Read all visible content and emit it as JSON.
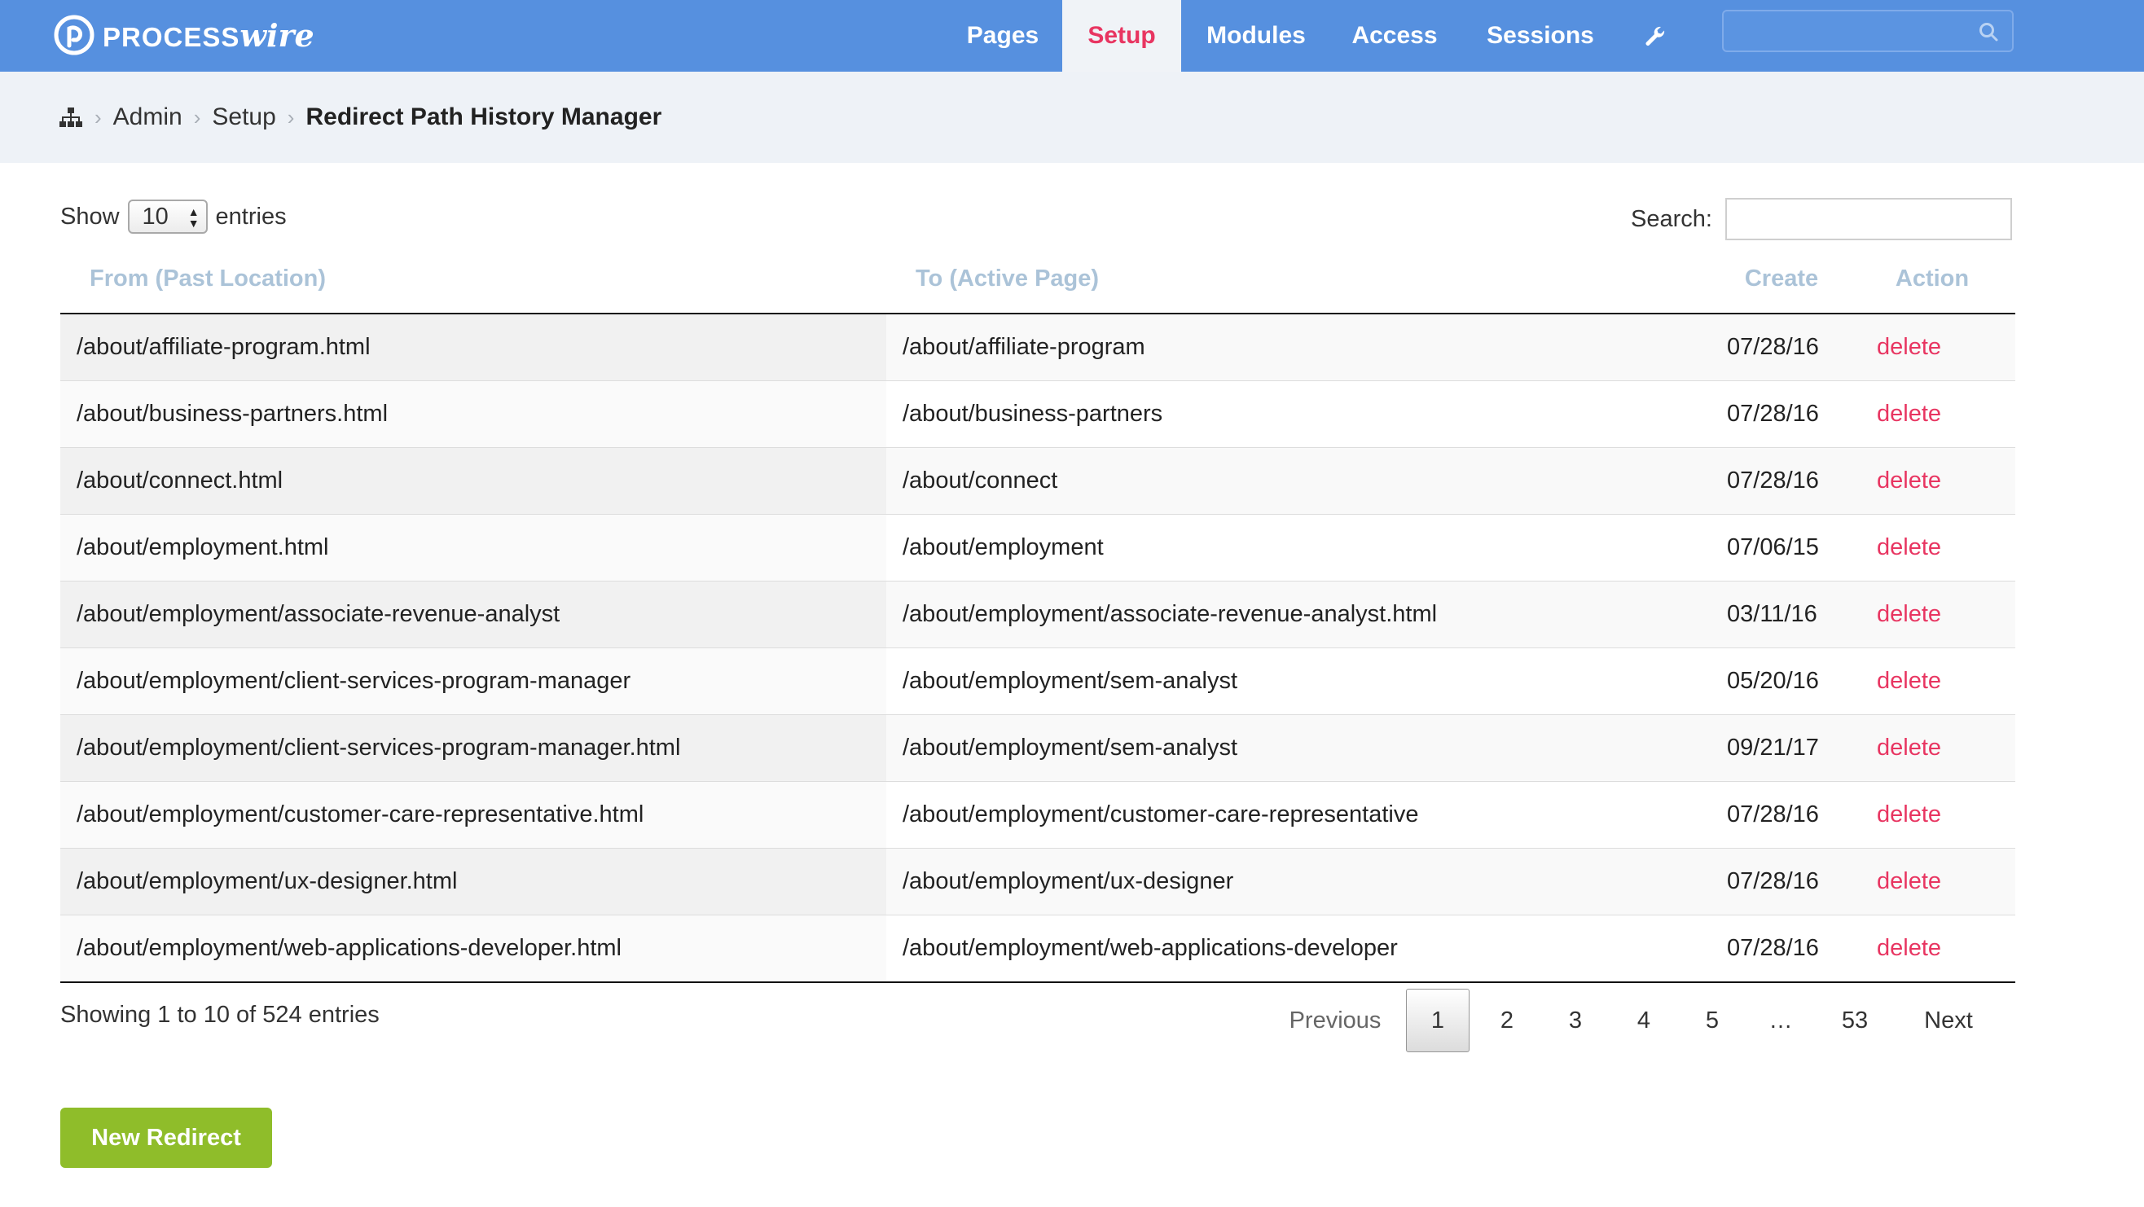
{
  "app": {
    "logo_text_a": "PROCESS",
    "logo_text_b": "wire",
    "brand_color": "#5690df",
    "accent_color": "#e83561"
  },
  "nav": {
    "items": [
      {
        "label": "Pages",
        "active": false
      },
      {
        "label": "Setup",
        "active": true
      },
      {
        "label": "Modules",
        "active": false
      },
      {
        "label": "Access",
        "active": false
      },
      {
        "label": "Sessions",
        "active": false
      }
    ],
    "tools_icon": "wrench-icon",
    "search_icon": "search-icon"
  },
  "breadcrumb": {
    "home_icon": "sitemap-icon",
    "items": [
      "Admin",
      "Setup"
    ],
    "current": "Redirect Path History Manager"
  },
  "controls": {
    "show_label": "Show",
    "entries_value": "10",
    "entries_label": "entries",
    "search_label": "Search:",
    "search_value": ""
  },
  "table": {
    "headers": [
      "From (Past Location)",
      "To (Active Page)",
      "Create",
      "Action"
    ],
    "rows": [
      {
        "from": "/about/affiliate-program.html",
        "to": "/about/affiliate-program",
        "created": "07/28/16",
        "action": "delete"
      },
      {
        "from": "/about/business-partners.html",
        "to": "/about/business-partners",
        "created": "07/28/16",
        "action": "delete"
      },
      {
        "from": "/about/connect.html",
        "to": "/about/connect",
        "created": "07/28/16",
        "action": "delete"
      },
      {
        "from": "/about/employment.html",
        "to": "/about/employment",
        "created": "07/06/15",
        "action": "delete"
      },
      {
        "from": "/about/employment/associate-revenue-analyst",
        "to": "/about/employment/associate-revenue-analyst.html",
        "created": "03/11/16",
        "action": "delete"
      },
      {
        "from": "/about/employment/client-services-program-manager",
        "to": "/about/employment/sem-analyst",
        "created": "05/20/16",
        "action": "delete"
      },
      {
        "from": "/about/employment/client-services-program-manager.html",
        "to": "/about/employment/sem-analyst",
        "created": "09/21/17",
        "action": "delete"
      },
      {
        "from": "/about/employment/customer-care-representative.html",
        "to": "/about/employment/customer-care-representative",
        "created": "07/28/16",
        "action": "delete"
      },
      {
        "from": "/about/employment/ux-designer.html",
        "to": "/about/employment/ux-designer",
        "created": "07/28/16",
        "action": "delete"
      },
      {
        "from": "/about/employment/web-applications-developer.html",
        "to": "/about/employment/web-applications-developer",
        "created": "07/28/16",
        "action": "delete"
      }
    ]
  },
  "footer": {
    "info": "Showing 1 to 10 of 524 entries",
    "pagination": {
      "previous": "Previous",
      "pages": [
        "1",
        "2",
        "3",
        "4",
        "5"
      ],
      "current": "1",
      "ellipsis": "…",
      "last": "53",
      "next": "Next"
    },
    "new_button": "New Redirect"
  }
}
